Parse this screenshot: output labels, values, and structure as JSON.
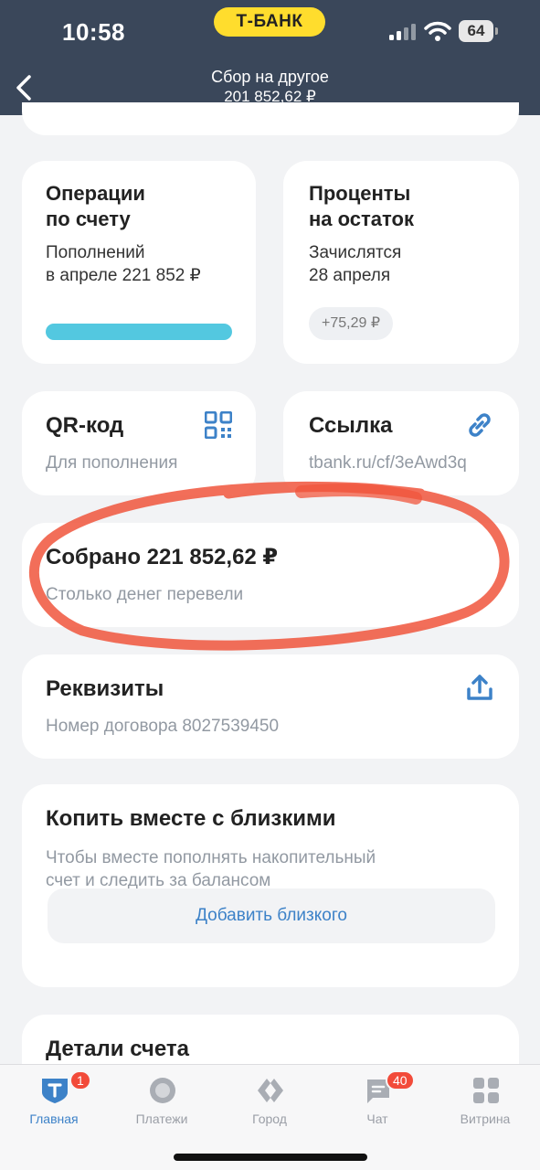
{
  "status_bar": {
    "time": "10:58",
    "brand": "Т-БАНК",
    "battery": "64"
  },
  "header": {
    "title": "Сбор на другое",
    "balance": "201 852,62 ₽"
  },
  "operations_card": {
    "title_line1": "Операции",
    "title_line2": "по счету",
    "text_line1": "Пополнений",
    "text_line2": "в апреле 221 852 ₽",
    "progress": 1.0
  },
  "interest_card": {
    "title_line1": "Проценты",
    "title_line2": "на остаток",
    "text_line1": "Зачислятся",
    "text_line2": "28 апреля",
    "chip": "+75,29 ₽"
  },
  "qr_card": {
    "title": "QR-код",
    "subtitle": "Для пополнения"
  },
  "link_card": {
    "title": "Ссылка",
    "subtitle": "tbank.ru/cf/3eAwd3q"
  },
  "collected_card": {
    "title": "Собрано 221 852,62 ₽",
    "subtitle": "Столько денег перевели"
  },
  "requisites_card": {
    "title": "Реквизиты",
    "subtitle": "Номер договора 8027539450"
  },
  "family_card": {
    "title": "Копить вместе с близкими",
    "text_line1": "Чтобы вместе пополнять накопительный",
    "text_line2": "счет и следить за балансом",
    "button": "Добавить близкого"
  },
  "details_card": {
    "title": "Детали счета"
  },
  "tab_bar": {
    "tabs": [
      {
        "label": "Главная",
        "badge": "1"
      },
      {
        "label": "Платежи"
      },
      {
        "label": "Город"
      },
      {
        "label": "Чат",
        "badge": "40"
      },
      {
        "label": "Витрина"
      }
    ]
  },
  "colors": {
    "header_bg": "#3a475a",
    "brand_yellow": "#ffdd2d",
    "accent_blue": "#3d82c8",
    "progress_cyan": "#53c8e0",
    "highlight_red": "#f0553c"
  }
}
